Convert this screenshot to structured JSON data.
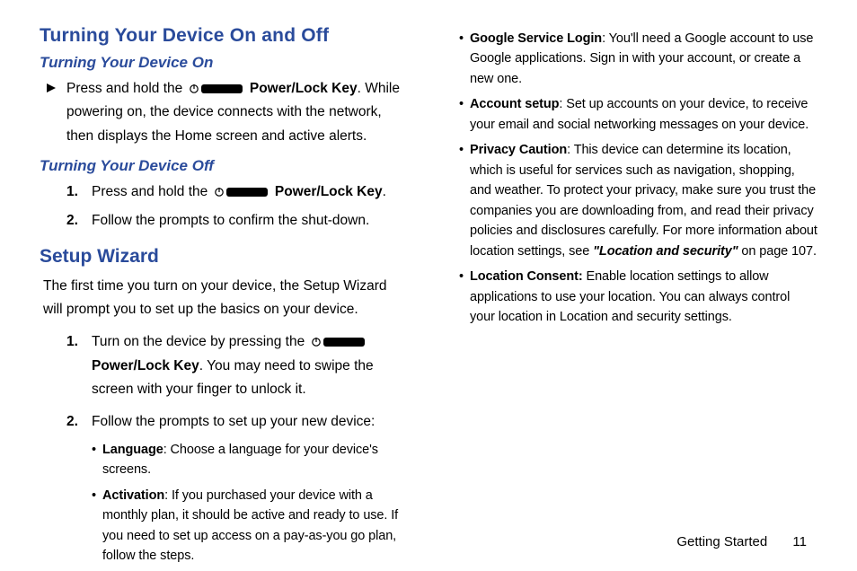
{
  "left": {
    "h1": "Turning Your Device On and Off",
    "h2a": "Turning Your Device On",
    "on_pre": "Press and hold the ",
    "on_key": "Power/Lock Key",
    "on_post": ". While powering on, the device connects with the network, then displays the Home screen and active alerts.",
    "h2b": "Turning Your Device Off",
    "off1_num": "1.",
    "off1_pre": "Press and hold the ",
    "off1_key": "Power/Lock Key",
    "off1_post": ".",
    "off2_num": "2.",
    "off2": "Follow the prompts to confirm the shut-down.",
    "h1b": "Setup Wizard",
    "sw_intro": "The first time you turn on your device, the Setup Wizard will prompt you to set up the basics on your device.",
    "sw1_num": "1.",
    "sw1_pre": "Turn on the device by pressing the ",
    "sw1_key": "Power/Lock Key",
    "sw1_post": ". You may need to swipe the screen with your finger to unlock it.",
    "sw2_num": "2.",
    "sw2": "Follow the prompts to set up your new device:",
    "b_lang_label": "Language",
    "b_lang_text": ": Choose a language for your device's screens.",
    "b_act_label": "Activation",
    "b_act_text": ": If you purchased your device with a monthly plan, it should be active and ready to use. If you need to set up access on a pay-as-you go plan, follow the steps."
  },
  "right": {
    "b_gsl_label": "Google Service Login",
    "b_gsl_text": ": You'll need a Google account to use Google applications. Sign in with your account, or create a new one.",
    "b_acc_label": "Account setup",
    "b_acc_text": ": Set up accounts on your device, to receive your email and social networking messages on your device.",
    "b_pc_label": "Privacy Caution",
    "b_pc_pre": ": This device can determine its location, which is useful for services such as navigation, shopping, and weather. To protect your privacy, make sure you trust the companies you are downloading from, and read their privacy policies and disclosures carefully. For more information about location settings, see ",
    "b_pc_ref": "\"Location and security\"",
    "b_pc_post": " on page 107.",
    "b_lc_label": "Location Consent:",
    "b_lc_text": " Enable location settings to allow applications to use your location. You can always control your location in Location and security settings."
  },
  "footer": {
    "section": "Getting Started",
    "page": "11"
  }
}
